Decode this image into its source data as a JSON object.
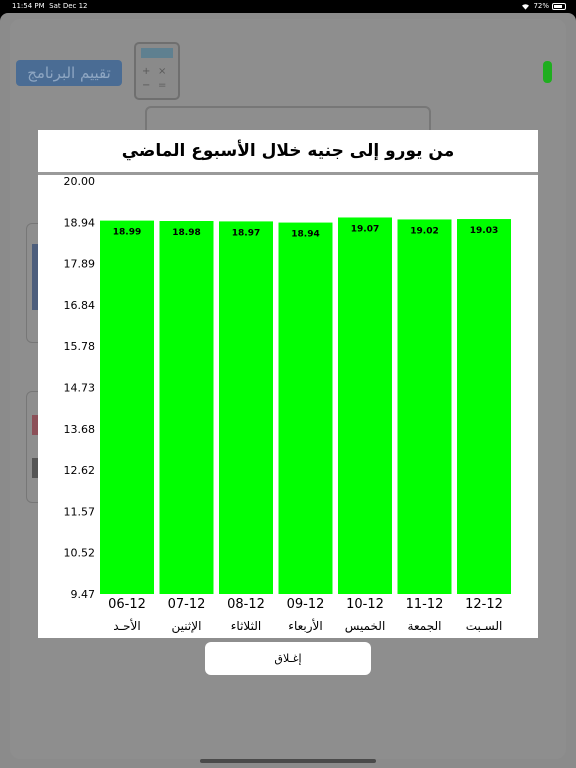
{
  "status_bar": {
    "time": "11:54 PM",
    "date": "Sat Dec 12",
    "battery": "72%"
  },
  "background": {
    "rate_button_label": "تقييم البرنامج",
    "calc_keys": [
      "+",
      "×",
      "−",
      "="
    ]
  },
  "modal": {
    "title": "من يورو إلى جنيه خلال الأسبوع الماضي",
    "close_label": "إغـلاق"
  },
  "chart_data": {
    "type": "bar",
    "title": "من يورو إلى جنيه خلال الأسبوع الماضي",
    "categories": [
      "06-12",
      "07-12",
      "08-12",
      "09-12",
      "10-12",
      "11-12",
      "12-12"
    ],
    "day_names": [
      "الأحـد",
      "الإثنين",
      "الثلاثاء",
      "الأربعاء",
      "الخميس",
      "الجمعة",
      "السـبت"
    ],
    "values": [
      18.99,
      18.98,
      18.97,
      18.94,
      19.07,
      19.02,
      19.03
    ],
    "value_labels": [
      "18.99",
      "18.98",
      "18.97",
      "18.94",
      "19.07",
      "19.02",
      "19.03"
    ],
    "y_ticks": [
      "20.00",
      "18.94",
      "17.89",
      "16.84",
      "15.78",
      "14.73",
      "13.68",
      "12.62",
      "11.57",
      "10.52",
      "9.47"
    ],
    "ylim": [
      9.47,
      20.0
    ],
    "bar_color": "#00ff00",
    "grid": false,
    "legend": "none"
  }
}
